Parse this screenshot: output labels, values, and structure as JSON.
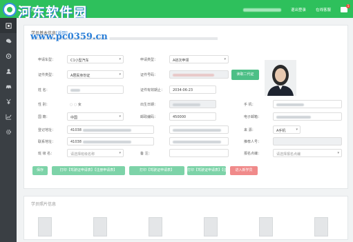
{
  "watermark": {
    "title": "河东软件园",
    "url": "www.pc0359.cn"
  },
  "topbar": {
    "nav": "首页 | ··· ",
    "logout": "退出登录",
    "service": "在线客服",
    "mail_badge": "1"
  },
  "sidebar": {
    "icons": [
      "home-icon",
      "chat-icon",
      "settings-icon",
      "user-icon",
      "car-icon",
      "yen-icon",
      "chart-icon",
      "gear-icon"
    ]
  },
  "form": {
    "title_prefix": "学员基本信息",
    "title_link": "[返回]",
    "labels": {
      "apply_vehicle": "申请车型：",
      "apply_type": "申请类型：",
      "id_type": "证件类型：",
      "id_number": "证件号码：",
      "name": "姓    名：",
      "id_expiry": "证件有效期止：",
      "gender": "性    别：",
      "birth": "出生日期：",
      "mobile": "手    机：",
      "nationality": "国    籍：",
      "postcode": "邮政编码：",
      "email": "电子邮箱：",
      "reg_address": "登记地址：",
      "source": "来    源：",
      "contact_address": "联系地址：",
      "referrer": "推荐人号：",
      "class": "班 级 名：",
      "remark": "备    注：",
      "training_site": "报名点编：",
      "read_card": "读取二代证"
    },
    "values": {
      "apply_vehicle": "C1小型汽车",
      "apply_type": "A初次申领",
      "id_type": "A居民身份证",
      "id_expiry": "2034-06-23",
      "gender": "女",
      "nationality": "中国",
      "postcode": "450000",
      "source": "A手机",
      "reg_address_prefix": "41038",
      "contact_address_prefix": "41038",
      "class_placeholder": "请选择班级名称",
      "site_placeholder": "请选择报名点编"
    }
  },
  "actions": {
    "save": "保存",
    "print_a": "打印【驾驶证申请表】【注册申请表】",
    "print_b": "打印【驾驶证申请表】",
    "print_c": "打印【驾驶证申请表】【注册申请表】",
    "enroll": "进入新学员"
  },
  "section2": {
    "title": "学员照片信息"
  }
}
